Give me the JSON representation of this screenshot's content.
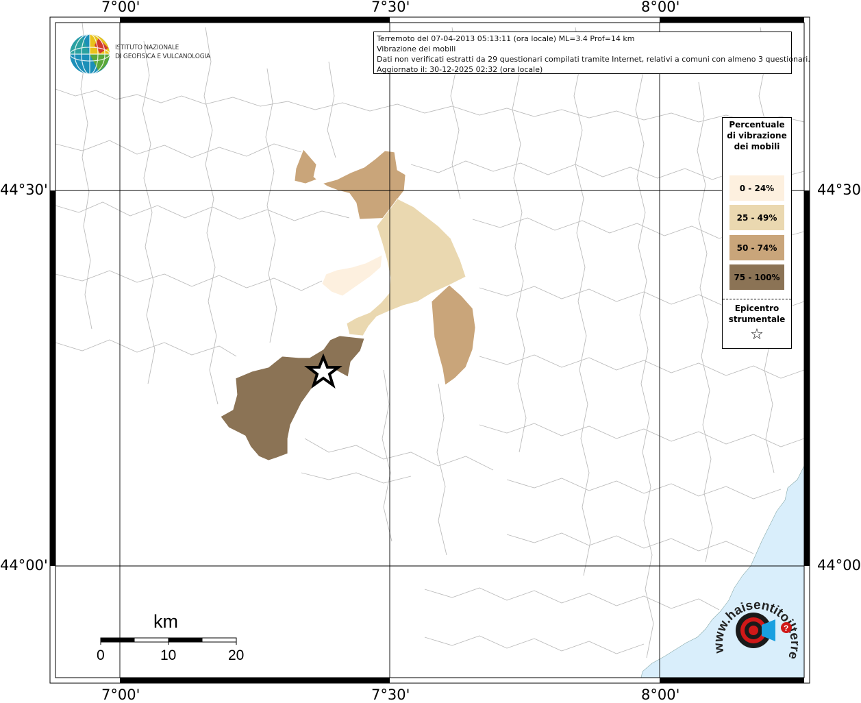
{
  "map": {
    "longitude_labels": [
      "7°00'",
      "7°30'",
      "8°00'"
    ],
    "latitude_labels": [
      "44°30'",
      "44°00'"
    ],
    "info": {
      "line1": "Terremoto del 07-04-2013 05:13:11 (ora locale) ML=3.4 Prof=14 km",
      "line2": "Vibrazione dei mobili",
      "line3": "Dati non verificati estratti da 29 questionari compilati tramite Internet, relativi a comuni con almeno 3 questionari.",
      "line4": "Aggiornato il: 30-12-2025 02:32 (ora locale)"
    },
    "logo": {
      "line1": "ISTITUTO NAZIONALE",
      "line2": "DI GEOFISICA E VULCANOLOGIA"
    },
    "legend": {
      "title": "Percentuale di vibrazione dei mobili",
      "items": [
        {
          "label": "0 - 24%",
          "color": "#fdf0df"
        },
        {
          "label": "25 - 49%",
          "color": "#ead8b0"
        },
        {
          "label": "50 - 74%",
          "color": "#c9a57a"
        },
        {
          "label": "75 - 100%",
          "color": "#8b7355"
        }
      ],
      "epicenter_label": "Epicentro strumentale",
      "epicenter_symbol": "☆"
    },
    "scale_bar": {
      "unit": "km",
      "ticks": [
        "0",
        "10",
        "20"
      ]
    },
    "watermark": {
      "text": "www.haisentitoilterremoto.it",
      "prefix": "www.",
      "main": "haisentitoil",
      "brand": "terremoto",
      "suffix": ".it"
    },
    "colors": {
      "sea": "#d9eefb",
      "border": "#bcbcbc",
      "grid": "#000000"
    }
  }
}
